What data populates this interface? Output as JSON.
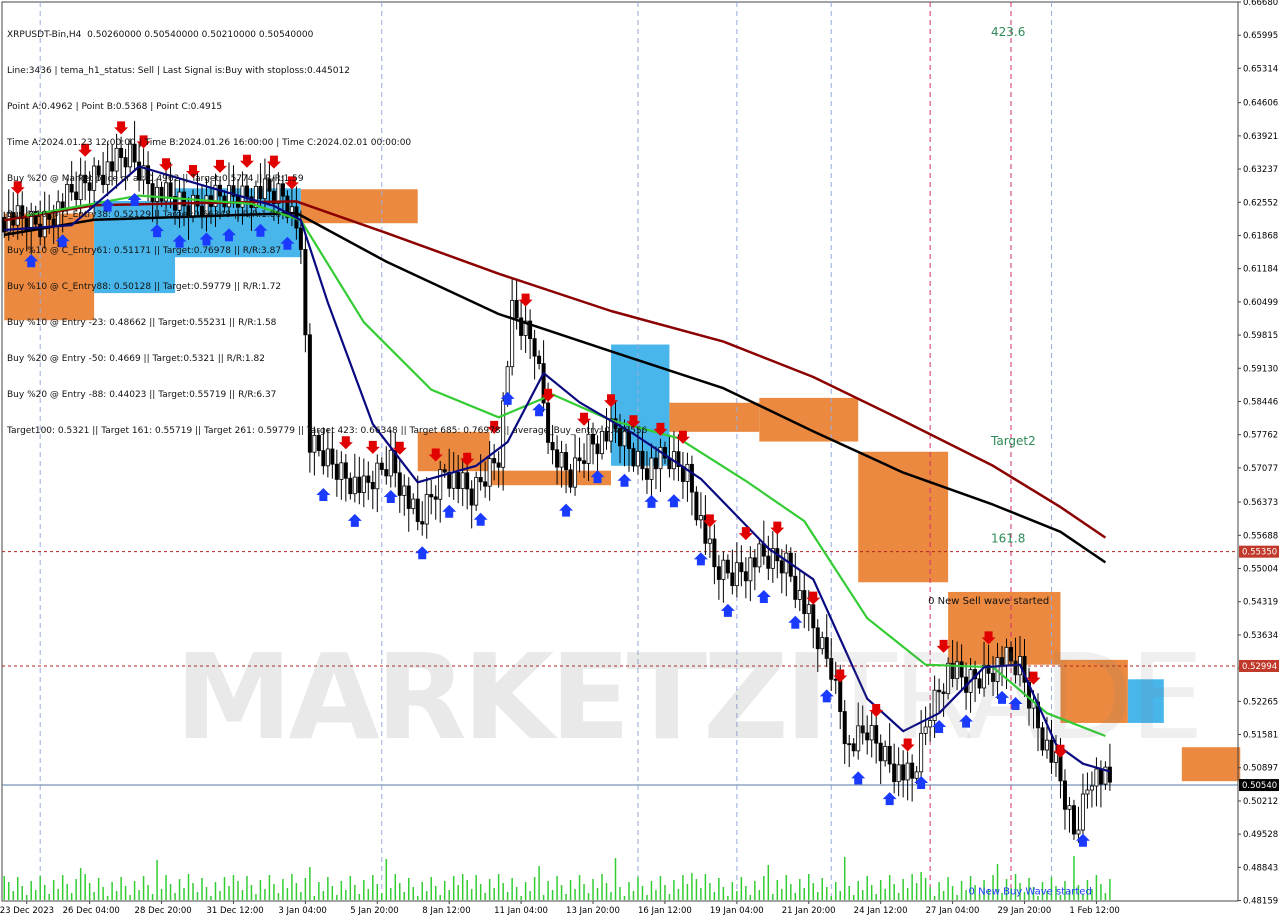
{
  "chart_header": {
    "title": "XRPUSDT-Bin,H4  0.50260000 0.50540000 0.50210000 0.50540000",
    "info_lines": [
      "Line:3436 | tema_h1_status: Sell | Last Signal is:Buy with stoploss:0.445012",
      "Point A:0.4962 | Point B:0.5368 | Point C:0.4915",
      "Time A:2024.01.23 12:00:00 | Time B:2024.01.26 16:00:00 | Time C:2024.02.01 00:00:00",
      "Buy %20 @ Market price or at: 0.4962 || Target:0.5774 || R/R:1.59",
      "Buy %10 @ C_Entry38: 0.52129 || Target:0.66348 || R/R:1.86",
      "Buy %10 @ C_Entry61: 0.51171 || Target:0.76978 || R/R:3.87",
      "Buy %10 @ C_Entry88: 0.50128 || Target:0.59779 || R/R:1.72",
      "Buy %10 @ Entry -23: 0.48662 || Target:0.55231 || R/R:1.58",
      "Buy %20 @ Entry -50: 0.4669 || Target:0.5321 || R/R:1.82",
      "Buy %20 @ Entry -88: 0.44023 || Target:0.55719 || R/R:6.37",
      "Target100: 0.5321 || Target 161: 0.55719 || Target 261: 0.59779 || Target 423: 0.66348 || Target 685: 0.76978 || average_Buy_entry: 0.488556"
    ]
  },
  "watermark": {
    "bold": "MARKETZI",
    "light": "TRADE"
  },
  "colors": {
    "background": "#ffffff",
    "bull_candle": "#000000",
    "sell_arrow": "#e00000",
    "buy_arrow": "#1a3bff",
    "ema_dark_red": "#8b0000",
    "ema_black": "#000000",
    "ema_green": "#33cc33",
    "tema_navy": "#0a0a80",
    "cloud_orange": "#e8741e",
    "cloud_blue": "#29a9e8",
    "level_line": "#b22222",
    "current_price_line": "#5577aa",
    "volume": "#33cc33",
    "annotation_green": "#2e8b57"
  },
  "chart_data": {
    "type": "candlestick",
    "symbol": "XRPUSDT-Bin",
    "timeframe": "H4",
    "ylim": [
      0.4815,
      0.6668
    ],
    "price_ticks": [
      "0.66680",
      "0.65995",
      "0.65314",
      "0.64606",
      "0.63921",
      "0.63237",
      "0.62552",
      "0.61868",
      "0.61184",
      "0.60499",
      "0.59815",
      "0.59130",
      "0.58446",
      "0.57762",
      "0.57077",
      "0.56373",
      "0.55688",
      "0.55004",
      "0.54319",
      "0.53634",
      "0.52950",
      "0.52265",
      "0.51581",
      "0.50897",
      "0.50212",
      "0.49528",
      "0.48843",
      "0.48159"
    ],
    "time_labels": [
      {
        "label": "23 Dec 2023",
        "bar": 5
      },
      {
        "label": "26 Dec 04:00",
        "bar": 19
      },
      {
        "label": "28 Dec 20:00",
        "bar": 35
      },
      {
        "label": "31 Dec 12:00",
        "bar": 51
      },
      {
        "label": "3 Jan 04:00",
        "bar": 67
      },
      {
        "label": "5 Jan 20:00",
        "bar": 83
      },
      {
        "label": "8 Jan 12:00",
        "bar": 99
      },
      {
        "label": "11 Jan 04:00",
        "bar": 115
      },
      {
        "label": "13 Jan 20:00",
        "bar": 131
      },
      {
        "label": "16 Jan 12:00",
        "bar": 147
      },
      {
        "label": "19 Jan 04:00",
        "bar": 163
      },
      {
        "label": "21 Jan 20:00",
        "bar": 179
      },
      {
        "label": "24 Jan 12:00",
        "bar": 195
      },
      {
        "label": "27 Jan 04:00",
        "bar": 211
      },
      {
        "label": "29 Jan 20:00",
        "bar": 227
      },
      {
        "label": "1 Feb 12:00",
        "bar": 243
      }
    ],
    "key_prices": [
      {
        "price": 0.6224,
        "bar": 0
      },
      {
        "price": 0.6208,
        "bar": 8
      },
      {
        "price": 0.6262,
        "bar": 14
      },
      {
        "price": 0.6312,
        "bar": 20
      },
      {
        "price": 0.6351,
        "bar": 28
      },
      {
        "price": 0.6274,
        "bar": 34
      },
      {
        "price": 0.6248,
        "bar": 40
      },
      {
        "price": 0.6262,
        "bar": 48
      },
      {
        "price": 0.6276,
        "bar": 56
      },
      {
        "price": 0.6268,
        "bar": 62
      },
      {
        "price": 0.6188,
        "bar": 66
      },
      {
        "price": 0.5752,
        "bar": 68
      },
      {
        "price": 0.5708,
        "bar": 74
      },
      {
        "price": 0.5661,
        "bar": 80
      },
      {
        "price": 0.5726,
        "bar": 86
      },
      {
        "price": 0.5591,
        "bar": 92
      },
      {
        "price": 0.5705,
        "bar": 98
      },
      {
        "price": 0.5649,
        "bar": 104
      },
      {
        "price": 0.5739,
        "bar": 110
      },
      {
        "price": 0.6023,
        "bar": 113
      },
      {
        "price": 0.5962,
        "bar": 118
      },
      {
        "price": 0.5733,
        "bar": 122
      },
      {
        "price": 0.5686,
        "bar": 126
      },
      {
        "price": 0.5759,
        "bar": 130
      },
      {
        "price": 0.5783,
        "bar": 136
      },
      {
        "price": 0.5712,
        "bar": 142
      },
      {
        "price": 0.5724,
        "bar": 148
      },
      {
        "price": 0.5697,
        "bar": 152
      },
      {
        "price": 0.5498,
        "bar": 158
      },
      {
        "price": 0.5489,
        "bar": 162
      },
      {
        "price": 0.5521,
        "bar": 168
      },
      {
        "price": 0.5514,
        "bar": 174
      },
      {
        "price": 0.5372,
        "bar": 180
      },
      {
        "price": 0.5296,
        "bar": 184
      },
      {
        "price": 0.5127,
        "bar": 188
      },
      {
        "price": 0.5165,
        "bar": 192
      },
      {
        "price": 0.5091,
        "bar": 198
      },
      {
        "price": 0.5062,
        "bar": 202
      },
      {
        "price": 0.5211,
        "bar": 206
      },
      {
        "price": 0.5293,
        "bar": 210
      },
      {
        "price": 0.5263,
        "bar": 214
      },
      {
        "price": 0.5283,
        "bar": 218
      },
      {
        "price": 0.5312,
        "bar": 222
      },
      {
        "price": 0.5295,
        "bar": 226
      },
      {
        "price": 0.5178,
        "bar": 230
      },
      {
        "price": 0.5091,
        "bar": 234
      },
      {
        "price": 0.4953,
        "bar": 238
      },
      {
        "price": 0.5082,
        "bar": 242
      },
      {
        "price": 0.5054,
        "bar": 246
      }
    ],
    "levels": [
      {
        "price": 0.5535,
        "label": "0.55350",
        "style": "dashed"
      },
      {
        "price": 0.52994,
        "label": "0.52994",
        "style": "dashed"
      },
      {
        "price": 0.5054,
        "label": "0.50540",
        "style": "solid"
      }
    ],
    "ema_dark_red": [
      {
        "bar": 0,
        "price": 0.6218
      },
      {
        "bar": 20,
        "price": 0.6249
      },
      {
        "bar": 40,
        "price": 0.6253
      },
      {
        "bar": 65,
        "price": 0.6257
      },
      {
        "bar": 85,
        "price": 0.6192
      },
      {
        "bar": 110,
        "price": 0.6108
      },
      {
        "bar": 135,
        "price": 0.6031
      },
      {
        "bar": 160,
        "price": 0.5968
      },
      {
        "bar": 180,
        "price": 0.5895
      },
      {
        "bar": 200,
        "price": 0.5805
      },
      {
        "bar": 220,
        "price": 0.5712
      },
      {
        "bar": 235,
        "price": 0.5627
      },
      {
        "bar": 245,
        "price": 0.5564
      }
    ],
    "ema_black": [
      {
        "bar": 0,
        "price": 0.6188
      },
      {
        "bar": 20,
        "price": 0.6219
      },
      {
        "bar": 40,
        "price": 0.6225
      },
      {
        "bar": 65,
        "price": 0.6233
      },
      {
        "bar": 85,
        "price": 0.6133
      },
      {
        "bar": 110,
        "price": 0.6025
      },
      {
        "bar": 135,
        "price": 0.5948
      },
      {
        "bar": 160,
        "price": 0.5872
      },
      {
        "bar": 180,
        "price": 0.5783
      },
      {
        "bar": 200,
        "price": 0.5698
      },
      {
        "bar": 220,
        "price": 0.5632
      },
      {
        "bar": 235,
        "price": 0.5576
      },
      {
        "bar": 245,
        "price": 0.5513
      }
    ],
    "ema_green": [
      {
        "bar": 5,
        "price": 0.6228
      },
      {
        "bar": 30,
        "price": 0.6269
      },
      {
        "bar": 55,
        "price": 0.6252
      },
      {
        "bar": 66,
        "price": 0.6218
      },
      {
        "bar": 80,
        "price": 0.6008
      },
      {
        "bar": 95,
        "price": 0.5869
      },
      {
        "bar": 110,
        "price": 0.5812
      },
      {
        "bar": 122,
        "price": 0.5859
      },
      {
        "bar": 135,
        "price": 0.5806
      },
      {
        "bar": 150,
        "price": 0.5769
      },
      {
        "bar": 165,
        "price": 0.5681
      },
      {
        "bar": 178,
        "price": 0.5598
      },
      {
        "bar": 192,
        "price": 0.5398
      },
      {
        "bar": 205,
        "price": 0.5302
      },
      {
        "bar": 220,
        "price": 0.5297
      },
      {
        "bar": 232,
        "price": 0.5202
      },
      {
        "bar": 245,
        "price": 0.5155
      }
    ],
    "tema_navy": [
      {
        "bar": 0,
        "price": 0.6198
      },
      {
        "bar": 15,
        "price": 0.6208
      },
      {
        "bar": 30,
        "price": 0.6329
      },
      {
        "bar": 45,
        "price": 0.6288
      },
      {
        "bar": 60,
        "price": 0.6248
      },
      {
        "bar": 66,
        "price": 0.6218
      },
      {
        "bar": 72,
        "price": 0.6048
      },
      {
        "bar": 82,
        "price": 0.5798
      },
      {
        "bar": 92,
        "price": 0.5678
      },
      {
        "bar": 105,
        "price": 0.5712
      },
      {
        "bar": 112,
        "price": 0.5761
      },
      {
        "bar": 120,
        "price": 0.5903
      },
      {
        "bar": 128,
        "price": 0.5843
      },
      {
        "bar": 140,
        "price": 0.5778
      },
      {
        "bar": 155,
        "price": 0.5685
      },
      {
        "bar": 170,
        "price": 0.5542
      },
      {
        "bar": 180,
        "price": 0.5478
      },
      {
        "bar": 192,
        "price": 0.5232
      },
      {
        "bar": 200,
        "price": 0.5165
      },
      {
        "bar": 208,
        "price": 0.5202
      },
      {
        "bar": 218,
        "price": 0.5297
      },
      {
        "bar": 226,
        "price": 0.5302
      },
      {
        "bar": 234,
        "price": 0.5138
      },
      {
        "bar": 240,
        "price": 0.5098
      },
      {
        "bar": 246,
        "price": 0.5082
      }
    ],
    "cloud_segments": [
      {
        "from": 0,
        "to": 20,
        "top": 0.6232,
        "bottom": 0.6012,
        "color": "orange"
      },
      {
        "from": 20,
        "to": 38,
        "top": 0.6258,
        "bottom": 0.6068,
        "color": "blue"
      },
      {
        "from": 38,
        "to": 66,
        "top": 0.6284,
        "bottom": 0.6142,
        "color": "blue"
      },
      {
        "from": 66,
        "to": 92,
        "top": 0.6282,
        "bottom": 0.6212,
        "color": "orange"
      },
      {
        "from": 92,
        "to": 108,
        "top": 0.5782,
        "bottom": 0.5701,
        "color": "orange"
      },
      {
        "from": 108,
        "to": 135,
        "top": 0.5702,
        "bottom": 0.5672,
        "color": "orange"
      },
      {
        "from": 135,
        "to": 148,
        "top": 0.5962,
        "bottom": 0.5712,
        "color": "blue"
      },
      {
        "from": 148,
        "to": 168,
        "top": 0.5842,
        "bottom": 0.5782,
        "color": "orange"
      },
      {
        "from": 168,
        "to": 190,
        "top": 0.5852,
        "bottom": 0.5762,
        "color": "orange"
      },
      {
        "from": 190,
        "to": 210,
        "top": 0.5741,
        "bottom": 0.5472,
        "color": "orange"
      },
      {
        "from": 210,
        "to": 235,
        "top": 0.5452,
        "bottom": 0.5302,
        "color": "orange"
      },
      {
        "from": 235,
        "to": 250,
        "top": 0.5312,
        "bottom": 0.5182,
        "color": "orange"
      },
      {
        "from": 250,
        "to": 258,
        "top": 0.5272,
        "bottom": 0.5182,
        "color": "blue"
      },
      {
        "from": 262,
        "to": 275,
        "top": 0.5132,
        "bottom": 0.5062,
        "color": "orange"
      }
    ],
    "sell_signal_bars": [
      3,
      18,
      26,
      31,
      36,
      42,
      48,
      54,
      60,
      64,
      76,
      82,
      88,
      96,
      103,
      109,
      116,
      121,
      129,
      135,
      140,
      146,
      151,
      157,
      165,
      172,
      180,
      186,
      194,
      201,
      209,
      219,
      229,
      235
    ],
    "buy_signal_bars": [
      6,
      13,
      23,
      29,
      34,
      39,
      45,
      50,
      57,
      63,
      71,
      78,
      86,
      93,
      99,
      106,
      112,
      119,
      125,
      132,
      138,
      144,
      149,
      155,
      161,
      169,
      176,
      183,
      190,
      197,
      204,
      208,
      214,
      222,
      225,
      240
    ],
    "vertical_markers": [
      {
        "bar": 8,
        "color": "#9ad",
        "style": "dash"
      },
      {
        "bar": 84,
        "color": "#9ad",
        "style": "dash"
      },
      {
        "bar": 141,
        "color": "#9ad",
        "style": "dash"
      },
      {
        "bar": 163,
        "color": "#9ad",
        "style": "dash"
      },
      {
        "bar": 184,
        "color": "#9ad",
        "style": "dash"
      },
      {
        "bar": 206,
        "color": "#d03070",
        "style": "dash"
      },
      {
        "bar": 224,
        "color": "#d03070",
        "style": "dash"
      },
      {
        "bar": 233,
        "color": "#9ad",
        "style": "dash"
      }
    ],
    "annotations": [
      {
        "text": "423.6",
        "bar": 224,
        "price": 0.6598
      },
      {
        "text": "Target2",
        "bar": 224,
        "price": 0.5755
      },
      {
        "text": "161.8",
        "bar": 224,
        "price": 0.5554
      },
      {
        "text": "0 New Sell wave started",
        "bar": 210,
        "price": 0.5427
      },
      {
        "text": "0 New Buy Wave started",
        "bar": 219,
        "price": 0.4828
      }
    ],
    "n_bars": 275
  }
}
